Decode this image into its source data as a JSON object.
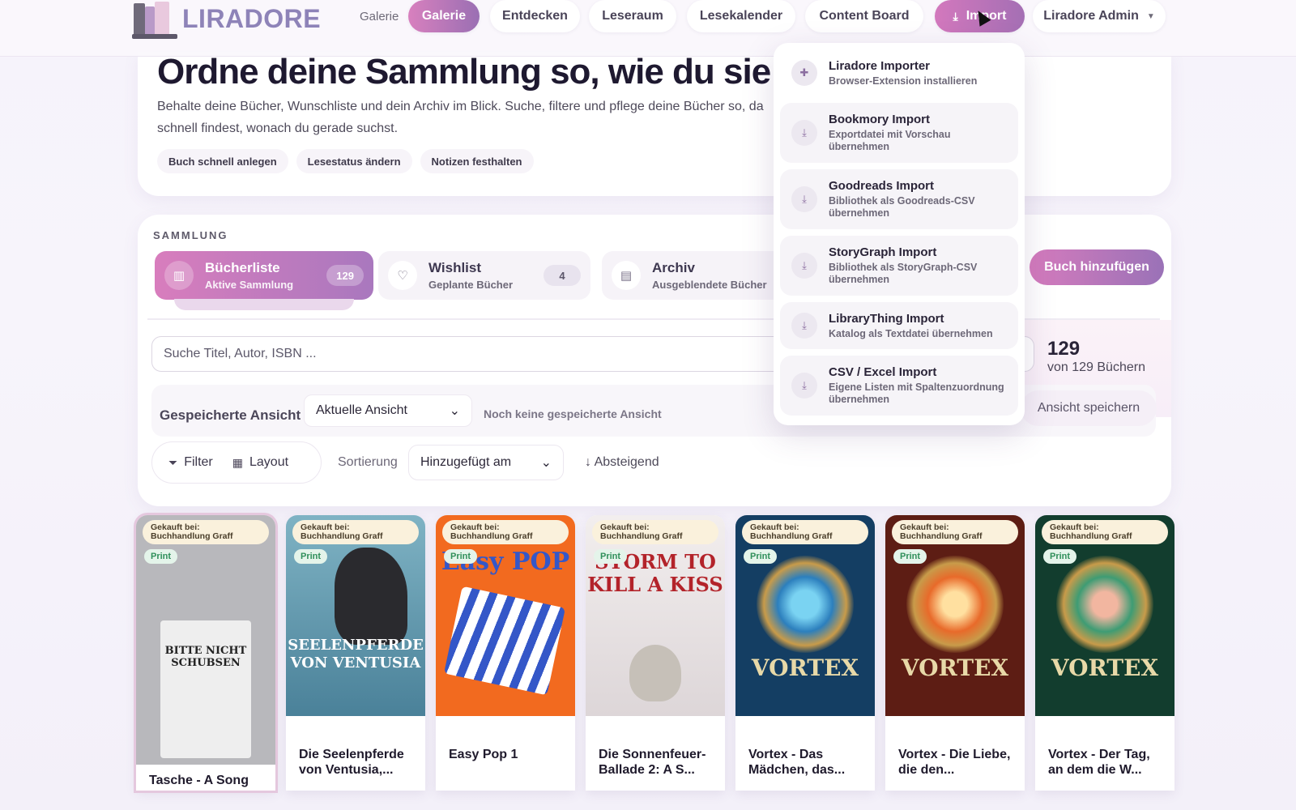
{
  "header": {
    "logo_text": "LIRADORE",
    "nav_plain": "Galerie",
    "nav": [
      {
        "label": "Galerie",
        "active": true
      },
      {
        "label": "Entdecken"
      },
      {
        "label": "Leseraum"
      },
      {
        "label": "Lesekalender"
      },
      {
        "label": "Content Board"
      }
    ],
    "import_label": "Import",
    "user_label": "Liradore Admin"
  },
  "hero": {
    "title": "Ordne deine Sammlung so, wie du sie",
    "text": "Behalte deine Bücher, Wunschliste und dein Archiv im Blick. Suche, filtere und pflege deine Bücher so, da schnell findest, wonach du gerade suchst.",
    "chips": [
      "Buch schnell anlegen",
      "Lesestatus ändern",
      "Notizen festhalten"
    ]
  },
  "collection": {
    "label": "SAMMLUNG",
    "tabs": [
      {
        "title": "Bücherliste",
        "sub": "Aktive Sammlung",
        "count": "129"
      },
      {
        "title": "Wishlist",
        "sub": "Geplante Bücher",
        "count": "4"
      },
      {
        "title": "Archiv",
        "sub": "Ausgeblendete Bücher",
        "count": ""
      }
    ],
    "add_button": "Buch hinzufügen",
    "search_placeholder": "Suche Titel, Autor, ISBN ...",
    "count_num": "129",
    "count_sub": "von 129 Büchern",
    "saved_label": "Gespeicherte Ansicht",
    "saved_select": "Aktuelle Ansicht",
    "no_saved": "Noch keine gespeicherte Ansicht",
    "save_view": "Ansicht speichern",
    "filter": "Filter",
    "layout": "Layout",
    "sort_label": "Sortierung",
    "sort_value": "Hinzugefügt am",
    "sort_dir": "↓ Absteigend"
  },
  "import_menu": [
    {
      "title": "Liradore Importer",
      "desc": "Browser-Extension installieren",
      "icon": "puzzle-icon"
    },
    {
      "title": "Bookmory Import",
      "desc": "Exportdatei mit Vorschau übernehmen",
      "icon": "download-icon"
    },
    {
      "title": "Goodreads Import",
      "desc": "Bibliothek als Goodreads-CSV übernehmen",
      "icon": "download-icon"
    },
    {
      "title": "StoryGraph Import",
      "desc": "Bibliothek als StoryGraph-CSV übernehmen",
      "icon": "download-icon"
    },
    {
      "title": "LibraryThing Import",
      "desc": "Katalog als Textdatei übernehmen",
      "icon": "download-icon"
    },
    {
      "title": "CSV / Excel Import",
      "desc": "Eigene Listen mit Spaltenzuordnung übernehmen",
      "icon": "download-icon"
    }
  ],
  "books": [
    {
      "title": "Tasche - A Song",
      "buy": "Gekauft bei: Buchhandlung Graff",
      "format": "Print",
      "cover_color": "#b8b8bc",
      "cover_text": "BITTE NICHT SCHUBSEN"
    },
    {
      "title": "Die Seelenpferde von Ventusia,...",
      "buy": "Gekauft bei: Buchhandlung Graff",
      "format": "Print",
      "cover_color": "#5f99ad",
      "cover_text": "SEELENPFERDE VON VENTUSIA"
    },
    {
      "title": "Easy Pop 1",
      "buy": "Gekauft bei: Buchhandlung Graff",
      "format": "Print",
      "cover_color": "#f26a1f",
      "cover_text": "Easy POP"
    },
    {
      "title": "Die Sonnenfeuer-Ballade 2: A S...",
      "buy": "Gekauft bei: Buchhandlung Graff",
      "format": "Print",
      "cover_color": "#e9e4e6",
      "cover_text": "STORM TO KILL A KISS"
    },
    {
      "title": "Vortex - Das Mädchen, das...",
      "buy": "Gekauft bei: Buchhandlung Graff",
      "format": "Print",
      "cover_color": "#1f5a8a",
      "cover_text": "VORTEX"
    },
    {
      "title": "Vortex - Die Liebe, die den...",
      "buy": "Gekauft bei: Buchhandlung Graff",
      "format": "Print",
      "cover_color": "#8a2b1c",
      "cover_text": "VORTEX"
    },
    {
      "title": "Vortex - Der Tag, an dem die W...",
      "buy": "Gekauft bei: Buchhandlung Graff",
      "format": "Print",
      "cover_color": "#1d5a44",
      "cover_text": "VORTEX"
    }
  ]
}
